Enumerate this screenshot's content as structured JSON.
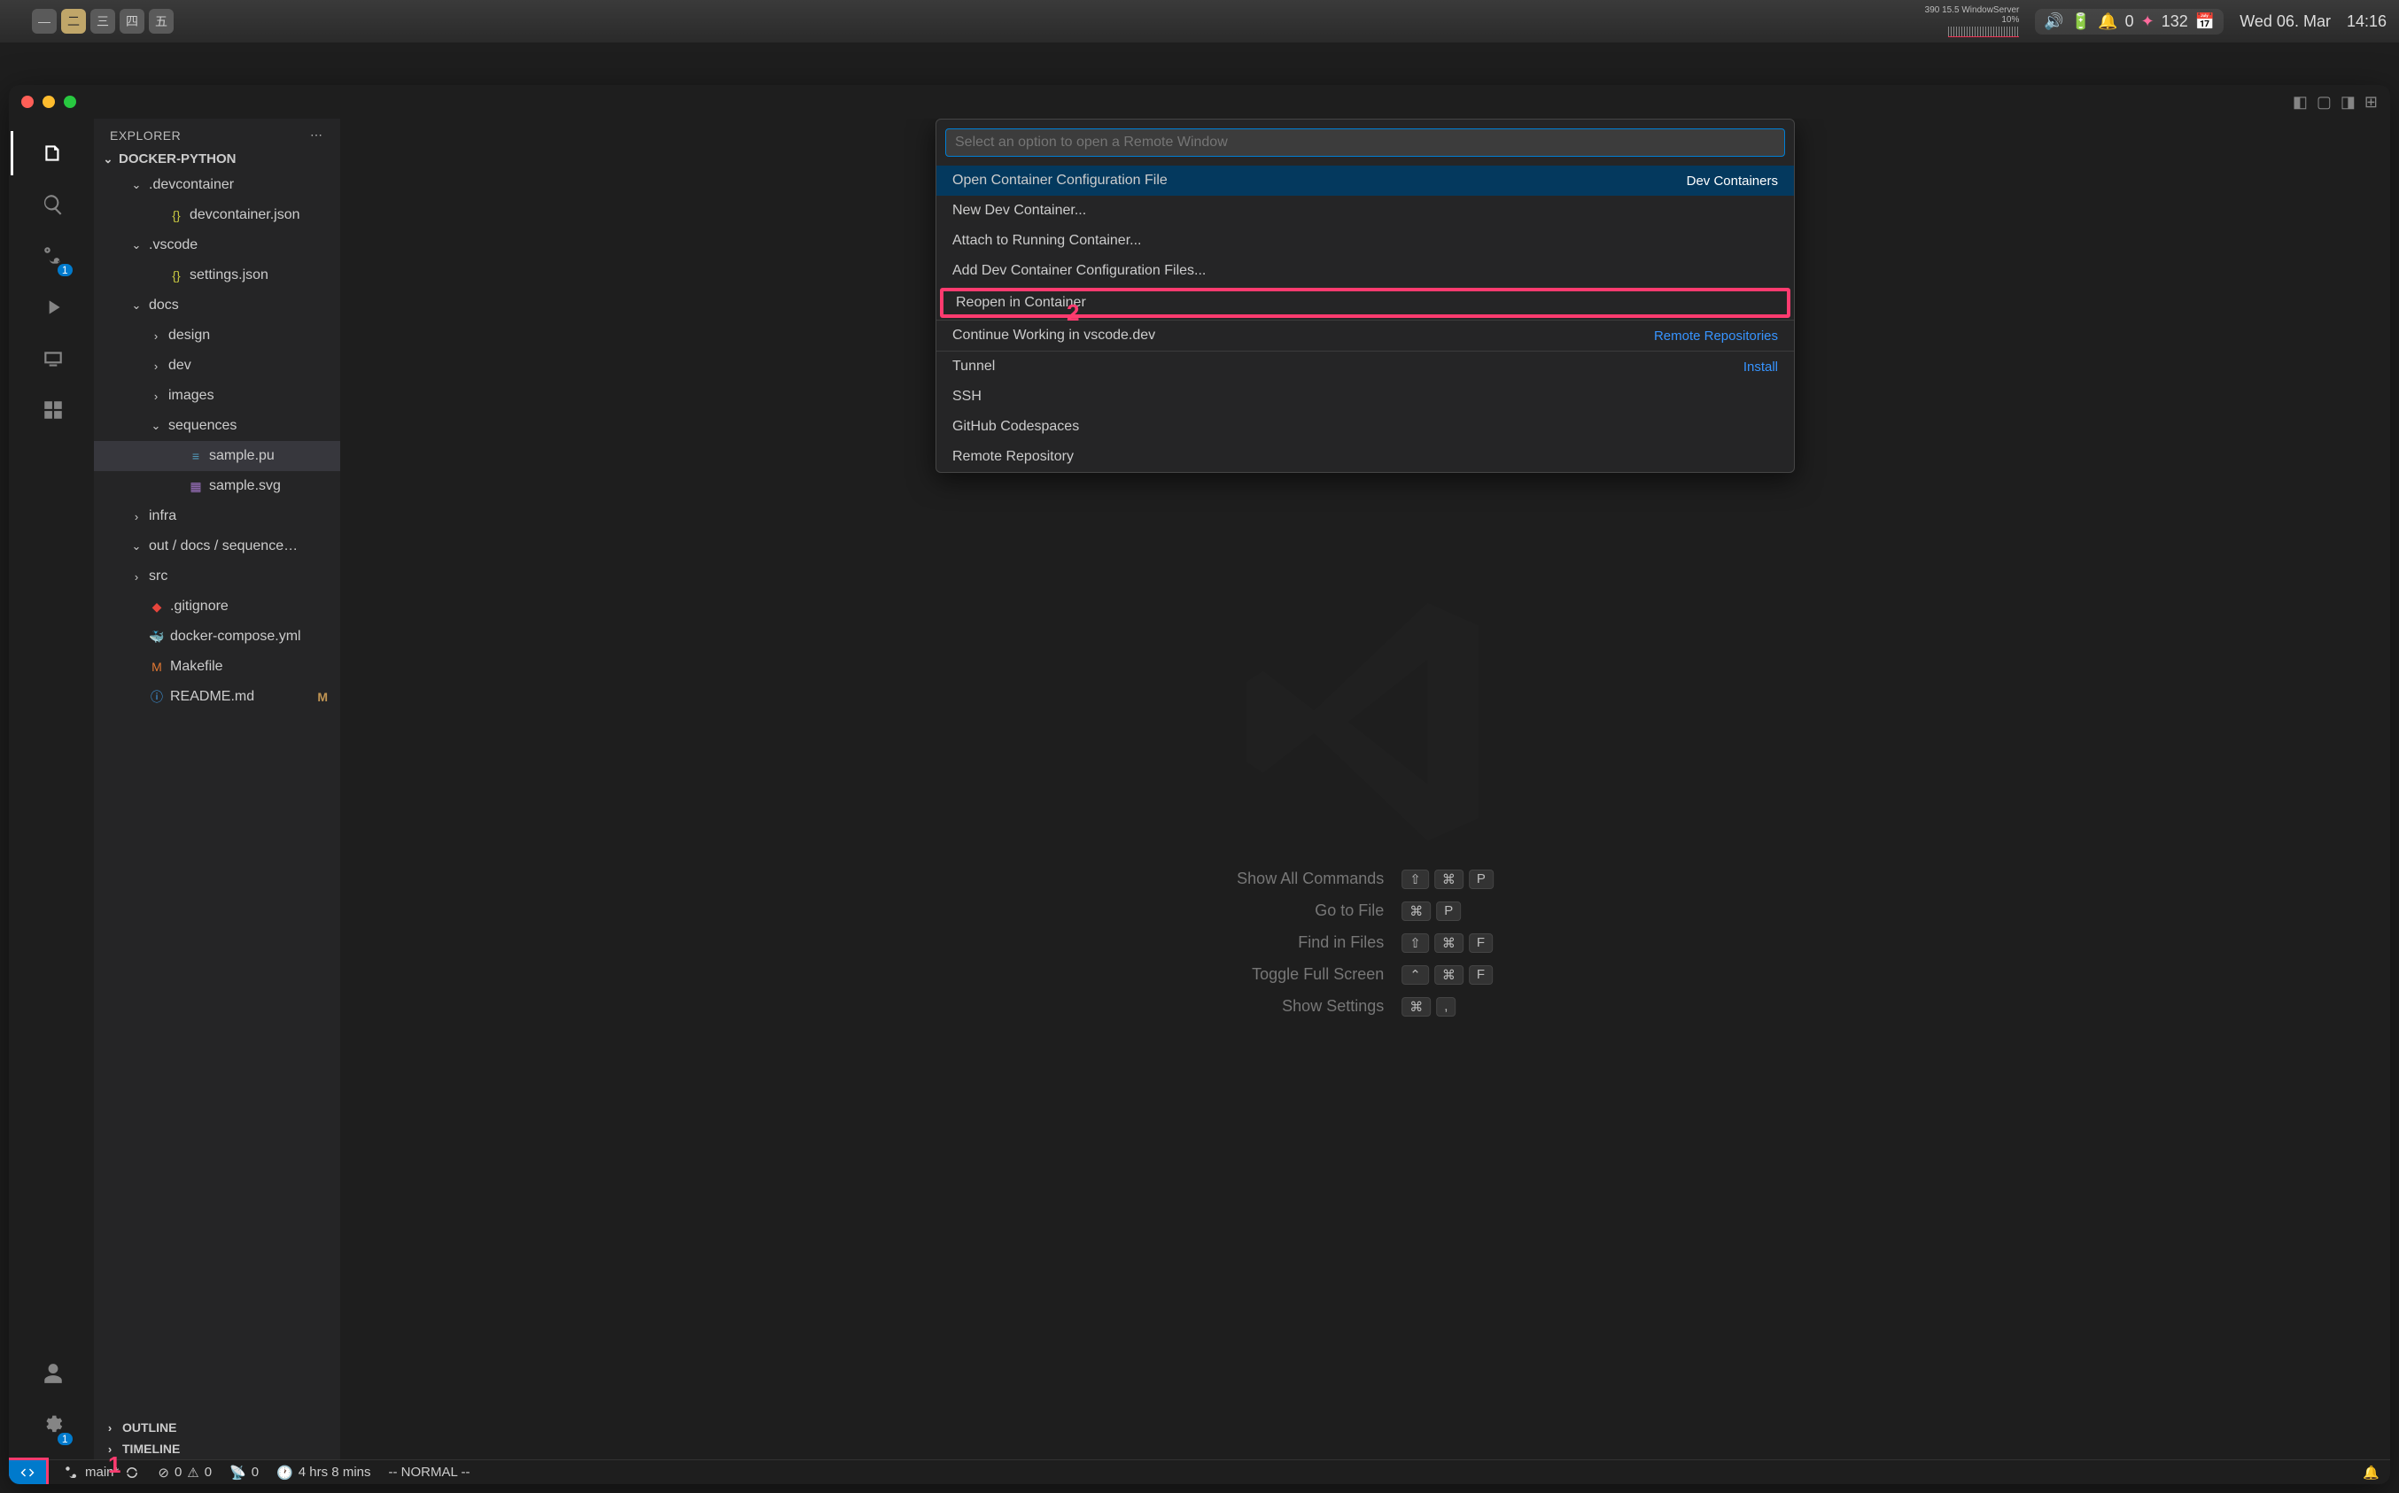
{
  "menubar": {
    "apps": [
      "—",
      "二",
      "三",
      "四",
      "五"
    ],
    "cpu": {
      "line1": "390  15.5 WindowServer",
      "line2": "10%"
    },
    "notif": "0",
    "count": "132",
    "date": "Wed 06. Mar",
    "time": "14:16"
  },
  "sidebar": {
    "title": "EXPLORER",
    "folder": "DOCKER-PYTHON",
    "outline": "OUTLINE",
    "timeline": "TIMELINE",
    "tree": [
      {
        "t": "folder-open",
        "indent": 1,
        "label": ".devcontainer"
      },
      {
        "t": "file",
        "indent": 2,
        "label": "devcontainer.json",
        "icon": "json"
      },
      {
        "t": "folder-open",
        "indent": 1,
        "label": ".vscode"
      },
      {
        "t": "file",
        "indent": 2,
        "label": "settings.json",
        "icon": "json"
      },
      {
        "t": "folder-open",
        "indent": 1,
        "label": "docs"
      },
      {
        "t": "folder-closed",
        "indent": 2,
        "label": "design"
      },
      {
        "t": "folder-closed",
        "indent": 2,
        "label": "dev"
      },
      {
        "t": "folder-closed",
        "indent": 2,
        "label": "images"
      },
      {
        "t": "folder-open",
        "indent": 2,
        "label": "sequences"
      },
      {
        "t": "file",
        "indent": 3,
        "label": "sample.pu",
        "icon": "pu",
        "selected": true
      },
      {
        "t": "file",
        "indent": 3,
        "label": "sample.svg",
        "icon": "svg"
      },
      {
        "t": "folder-closed",
        "indent": 1,
        "label": "infra"
      },
      {
        "t": "folder-open",
        "indent": 1,
        "label": "out / docs / sequence…"
      },
      {
        "t": "folder-closed",
        "indent": 1,
        "label": "src"
      },
      {
        "t": "file",
        "indent": 1,
        "label": ".gitignore",
        "icon": "git"
      },
      {
        "t": "file",
        "indent": 1,
        "label": "docker-compose.yml",
        "icon": "docker"
      },
      {
        "t": "file",
        "indent": 1,
        "label": "Makefile",
        "icon": "make"
      },
      {
        "t": "file",
        "indent": 1,
        "label": "README.md",
        "icon": "readme",
        "badge": "M"
      }
    ]
  },
  "palette": {
    "placeholder": "Select an option to open a Remote Window",
    "items": [
      {
        "label": "Open Container Configuration File",
        "right": "Dev Containers",
        "active": true
      },
      {
        "label": "New Dev Container..."
      },
      {
        "label": "Attach to Running Container..."
      },
      {
        "label": "Add Dev Container Configuration Files..."
      },
      {
        "label": "Reopen in Container",
        "highlighted": true
      },
      {
        "label": "Continue Working in vscode.dev",
        "right": "Remote Repositories",
        "sepBefore": true
      },
      {
        "label": "Tunnel",
        "right": "Install",
        "sepBefore": true
      },
      {
        "label": "SSH"
      },
      {
        "label": "GitHub Codespaces"
      },
      {
        "label": "Remote Repository"
      }
    ]
  },
  "welcome": {
    "cmds": [
      {
        "label": "Show All Commands",
        "keys": [
          "⇧",
          "⌘",
          "P"
        ]
      },
      {
        "label": "Go to File",
        "keys": [
          "⌘",
          "P"
        ]
      },
      {
        "label": "Find in Files",
        "keys": [
          "⇧",
          "⌘",
          "F"
        ]
      },
      {
        "label": "Toggle Full Screen",
        "keys": [
          "⌃",
          "⌘",
          "F"
        ]
      },
      {
        "label": "Show Settings",
        "keys": [
          "⌘",
          ","
        ]
      }
    ]
  },
  "status": {
    "branch": "main*",
    "err": "0",
    "warn": "0",
    "port": "0",
    "time": "4 hrs 8 mins",
    "mode": "-- NORMAL --"
  },
  "annot": {
    "n1": "1",
    "n2": "2"
  }
}
